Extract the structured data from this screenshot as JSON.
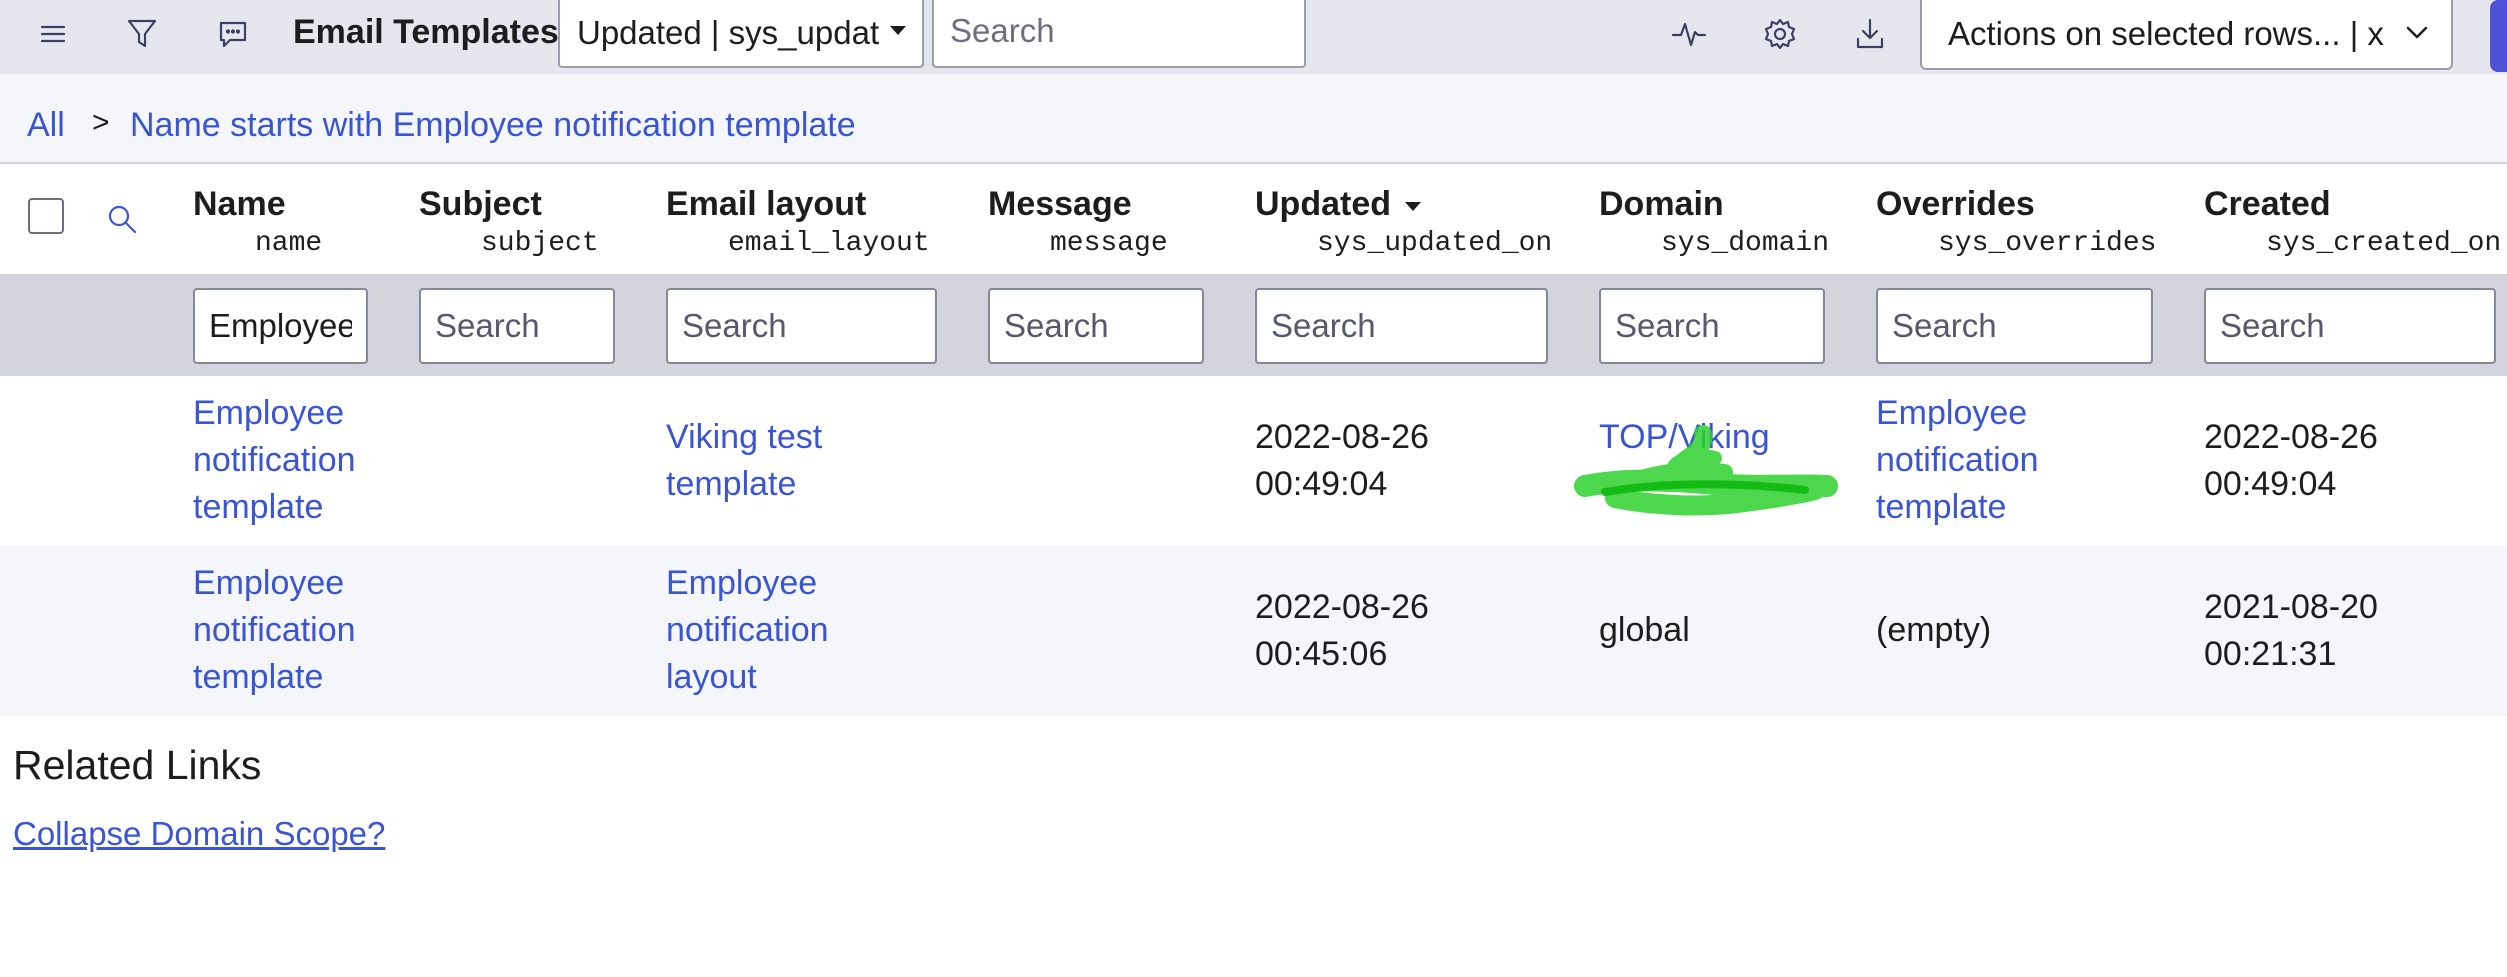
{
  "toolbar": {
    "title": "Email Templates",
    "sort_select_value": "Updated | sys_updat",
    "search_placeholder": "Search",
    "actions_select_value": "Actions on selected rows... | x"
  },
  "breadcrumb": {
    "all": "All",
    "separator": ">",
    "filter": "Name starts with Employee notification template"
  },
  "columns": [
    {
      "label": "Name",
      "field": "name",
      "filter_value": "Employee"
    },
    {
      "label": "Subject",
      "field": "subject",
      "filter_placeholder": "Search"
    },
    {
      "label": "Email layout",
      "field": "email_layout",
      "filter_placeholder": "Search"
    },
    {
      "label": "Message",
      "field": "message",
      "filter_placeholder": "Search"
    },
    {
      "label": "Updated",
      "field": "sys_updated_on",
      "filter_placeholder": "Search",
      "sorted": "descending"
    },
    {
      "label": "Domain",
      "field": "sys_domain",
      "filter_placeholder": "Search"
    },
    {
      "label": "Overrides",
      "field": "sys_overrides",
      "filter_placeholder": "Search"
    },
    {
      "label": "Created",
      "field": "sys_created_on",
      "filter_placeholder": "Search"
    }
  ],
  "rows": [
    {
      "name": [
        "Employee",
        "notification",
        "template"
      ],
      "email_layout": [
        "Viking test",
        "template"
      ],
      "updated": [
        "2022-08-26",
        "00:49:04"
      ],
      "domain": [
        "TOP/Viking",
        ""
      ],
      "overrides": [
        "Employee",
        "notification",
        "template"
      ],
      "created": [
        "2022-08-26",
        "00:49:04"
      ]
    },
    {
      "name": [
        "Employee",
        "notification",
        "template"
      ],
      "email_layout": [
        "Employee",
        "notification",
        "layout"
      ],
      "updated": [
        "2022-08-26",
        "00:45:06"
      ],
      "domain": [
        "global"
      ],
      "overrides": [
        "(empty)"
      ],
      "created": [
        "2021-08-20",
        "00:21:31"
      ]
    }
  ],
  "related": {
    "title": "Related Links",
    "link": "Collapse Domain Scope",
    "help": "?"
  },
  "colors": {
    "link": "#3a55d4",
    "toolbar_bg": "#e6e7ee",
    "filter_row_bg": "#d4d5dc",
    "redaction": "#2fd12f"
  },
  "icons": [
    "hamburger-menu-icon",
    "filter-funnel-icon",
    "chat-icon",
    "activity-pulse-icon",
    "gear-icon",
    "download-icon",
    "search-icon",
    "chevron-down-icon"
  ]
}
